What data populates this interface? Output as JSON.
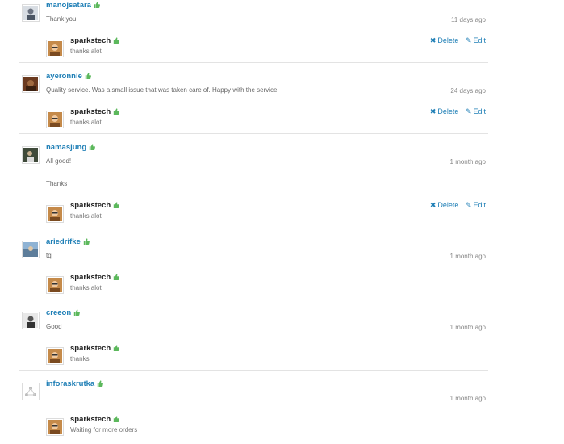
{
  "colors": {
    "link": "#1f7fb6",
    "thumb": "#5cb85c",
    "divider": "#e3e3e3"
  },
  "icons": {
    "thumb": "thumbs-up-icon",
    "delete": "times-icon",
    "edit": "edit-icon"
  },
  "actions": {
    "delete_label": "Delete",
    "edit_label": "Edit"
  },
  "reviews": [
    {
      "user": "manojsatara",
      "message": "Thank you.",
      "time": "11 days ago",
      "reply": {
        "user": "sparkstech",
        "message": "thanks alot",
        "editable": true
      }
    },
    {
      "user": "ayeronnie",
      "message": "Quality service. Was a small issue that was taken care of. Happy with the service.",
      "time": "24 days ago",
      "reply": {
        "user": "sparkstech",
        "message": "thanks alot",
        "editable": true
      }
    },
    {
      "user": "namasjung",
      "message": "All good!",
      "message2": "Thanks",
      "time": "1 month ago",
      "reply": {
        "user": "sparkstech",
        "message": "thanks alot",
        "editable": true
      }
    },
    {
      "user": "ariedrifke",
      "message": "tq",
      "time": "1 month ago",
      "reply": {
        "user": "sparkstech",
        "message": "thanks alot",
        "editable": false
      }
    },
    {
      "user": "creeon",
      "message": "Good",
      "time": "1 month ago",
      "reply": {
        "user": "sparkstech",
        "message": "thanks",
        "editable": false
      }
    },
    {
      "user": "inforaskrutka",
      "message": "",
      "time": "1 month ago",
      "reply": {
        "user": "sparkstech",
        "message": "Waiting for more orders",
        "editable": false
      }
    }
  ]
}
